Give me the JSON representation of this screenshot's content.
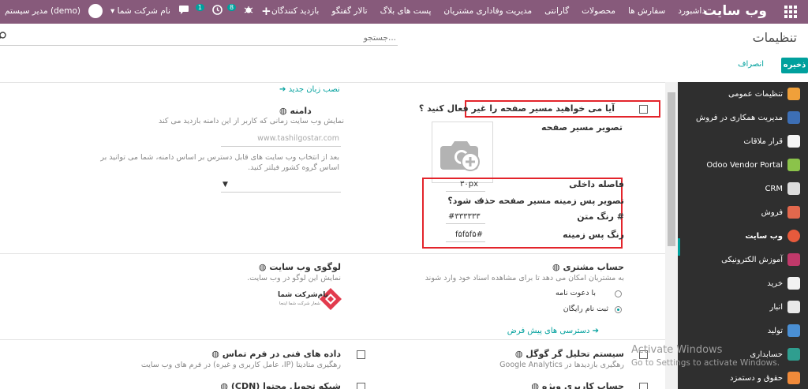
{
  "navbar": {
    "brand": "وب سایت",
    "menu": [
      "داشبورد",
      "سفارش ها",
      "محصولات",
      "گارانتی",
      "مدیریت وفاداری مشتریان",
      "پست های بلاگ",
      "تالار گفتگو",
      "بازدید کنندگان"
    ],
    "plus": "+",
    "company": "نام شرکت شما",
    "user": "مدیر سیستم (demo)",
    "activity_badge": "8",
    "messages_badge": "1",
    "icons": [
      "apps-icon",
      "plus-icon",
      "bug-icon",
      "clock-icon",
      "chat-icon",
      "avatar"
    ]
  },
  "control_panel": {
    "title": "تنظیمات",
    "search_placeholder": "جستجو...",
    "save": "ذخیره",
    "cancel": "انصراف"
  },
  "sidebar": {
    "items": [
      {
        "label": "تنظیمات عمومی",
        "icon": "gear-icon",
        "color": "#f0a03a"
      },
      {
        "label": "مدیریت همکاری در فروش",
        "icon": "handshake-icon",
        "color": "#3d6fb5"
      },
      {
        "label": "قرار ملاقات",
        "icon": "calendar-icon",
        "color": "#f5f5f5"
      },
      {
        "label": "Odoo Vendor Portal",
        "icon": "portal-icon",
        "color": "#8bc34a"
      },
      {
        "label": "CRM",
        "icon": "crm-icon",
        "color": "#dcdcdc"
      },
      {
        "label": "فروش",
        "icon": "sales-icon",
        "color": "#e3684d"
      },
      {
        "label": "وب سایت",
        "icon": "globe-icon",
        "color": "#e65a3c"
      },
      {
        "label": "آموزش الکترونیکی",
        "icon": "elearning-icon",
        "color": "#c0396a"
      },
      {
        "label": "خرید",
        "icon": "purchase-icon",
        "color": "#f2f2f2"
      },
      {
        "label": "انبار",
        "icon": "inventory-icon",
        "color": "#e8e8e8"
      },
      {
        "label": "تولید",
        "icon": "mrp-icon",
        "color": "#4a8fd4"
      },
      {
        "label": "حسابداری",
        "icon": "accounting-icon",
        "color": "#2f9e8f"
      },
      {
        "label": "حقوق و دستمزد",
        "icon": "payroll-icon",
        "color": "#f08a3a"
      }
    ]
  },
  "settings": {
    "install_language": "نصب زبان جدید",
    "domain": {
      "title": "دامنه",
      "desc": "نمایش وب سایت زمانی که کاربر از این دامنه بازدید می کند",
      "placeholder": "www.tashilgostar.com",
      "desc2_line1": "بعد از انتخاب وب سایت های قابل دسترس بر اساس دامنه، شما می توانید بر",
      "desc2_line2": "اساس گروه کشور فیلتر کنید."
    },
    "breadcrumb_question": "آیا می خواهید مسیر صفحه را غیر فعال کنید ؟",
    "breadcrumb_image": "تصویر مسیر صفحه",
    "padding_label": "فاصله داخلی",
    "padding_value": "۳۰px",
    "remove_bg_label": "تصویر پس زمینه مسیر صفحه حذف شود؟",
    "text_color_label": "رنگ متن #",
    "text_color_value": "#۳۳۳۳۳۳",
    "bg_color_label": "رنگ پس زمینه",
    "bg_color_value": "f۵f۵f۵#",
    "account": {
      "title": "حساب مشتری",
      "desc": "به مشتریان امکان می دهد تا برای مشاهده اسناد خود وارد شوند",
      "opt1": "با دعوت نامه",
      "opt2": "ثبت نام رایگان",
      "default_access": "دسترسی های پیش فرض"
    },
    "logo": {
      "title": "لوگوی وب سایت",
      "desc": "نمایش این لوگو در وب سایت.",
      "company_name": "نام‌شرکت شما",
      "company_sub": "شعار شرکت شما اینجا"
    },
    "google_analytics": {
      "title": "سیستم تحلیل گر گوگل",
      "desc": "رهگیری بازدیدها در Google Analytics"
    },
    "contact_form": {
      "title": "داده های فنی در فرم تماس",
      "desc": "رهگیری متادیتا (IP، عامل کاربری و غیره) در فرم های وب سایت"
    },
    "special_account": "حساب کاربری ویژه",
    "cdn": "شبکه تحویل محتوا (CDN)"
  },
  "watermark": {
    "line1": "Activate Windows",
    "line2": "Go to Settings to activate Windows."
  },
  "colors": {
    "navbar": "#875a7b",
    "accent": "#00a09d",
    "sidebar": "#2f2f2f",
    "highlight_border": "#e3242b"
  }
}
